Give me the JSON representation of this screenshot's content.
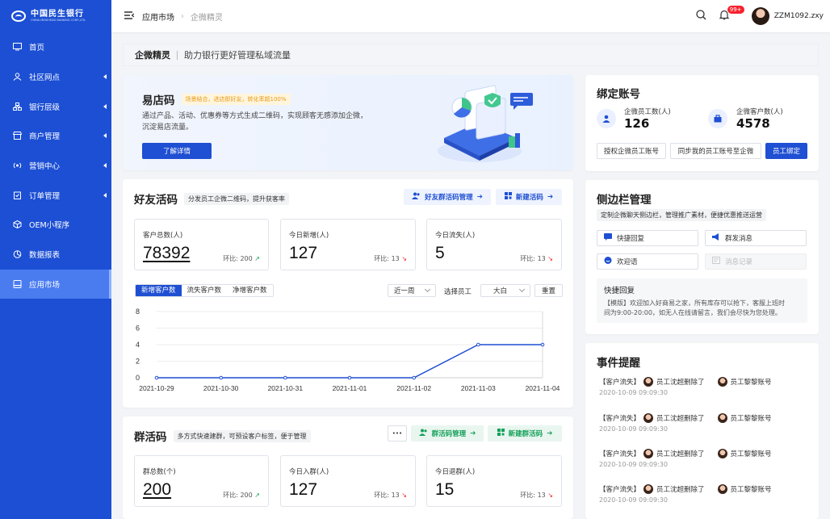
{
  "sidebar": {
    "logo_cn": "中国民生银行",
    "logo_en": "CHINA MINSHENG BANKING CORP.,LTD.",
    "items": [
      {
        "label": "首页",
        "icon": "monitor-icon",
        "submenu": false,
        "active": false
      },
      {
        "label": "社区网点",
        "icon": "community-icon",
        "submenu": true,
        "active": false
      },
      {
        "label": "银行层级",
        "icon": "hierarchy-icon",
        "submenu": true,
        "active": false
      },
      {
        "label": "商户管理",
        "icon": "store-icon",
        "submenu": true,
        "active": false
      },
      {
        "label": "营销中心",
        "icon": "broadcast-icon",
        "submenu": true,
        "active": false
      },
      {
        "label": "订单管理",
        "icon": "clipboard-icon",
        "submenu": true,
        "active": false
      },
      {
        "label": "OEM小程序",
        "icon": "cube-icon",
        "submenu": false,
        "active": false
      },
      {
        "label": "数据报表",
        "icon": "pie-chart-icon",
        "submenu": false,
        "active": false
      },
      {
        "label": "应用市场",
        "icon": "app-icon",
        "submenu": false,
        "active": true
      }
    ]
  },
  "topbar": {
    "breadcrumb": [
      "应用市场",
      "企微精灵"
    ],
    "badge": "99+",
    "username": "ZZM1092.zxy"
  },
  "page_header": {
    "title": "企微精灵",
    "desc": "助力银行更好管理私域流量"
  },
  "easy_store": {
    "title": "易店码",
    "tag": "场景结合，进店即好友，转化率超100%",
    "desc_line1": "通过产品、活动、优惠券等方式生成二维码，实现顾客无感添加企微，",
    "desc_line2": "沉淀易店流量。",
    "button": "了解详情"
  },
  "friend_code": {
    "title": "好友活码",
    "tag": "分发员工企微二维码，提升获客率",
    "btn_manage": "好友群活码管理",
    "btn_new": "新建活码",
    "stats": [
      {
        "label": "客户总数(人)",
        "value": "78392",
        "compare_label": "环比:",
        "compare_value": "200",
        "trend": "up",
        "underline": true
      },
      {
        "label": "今日新增(人)",
        "value": "127",
        "compare_label": "环比:",
        "compare_value": "13",
        "trend": "down",
        "underline": false
      },
      {
        "label": "今日流失(人)",
        "value": "5",
        "compare_label": "环比:",
        "compare_value": "13",
        "trend": "down",
        "underline": false
      }
    ],
    "tabs": [
      "新增客户数",
      "流失客户数",
      "净增客户数"
    ],
    "active_tab": 0,
    "filter_range": "近一周",
    "filter_label": "选择员工",
    "filter_staff": "大白",
    "reset": "重置"
  },
  "chart_data": {
    "type": "line",
    "x": [
      "2021-10-29",
      "2021-10-30",
      "2021-10-31",
      "2021-11-01",
      "2021-11-02",
      "2021-11-03",
      "2021-11-04"
    ],
    "y_ticks": [
      0,
      2,
      4,
      6,
      8
    ],
    "ylim": [
      0,
      8
    ],
    "series": [
      {
        "values": [
          0,
          0,
          0,
          0,
          0,
          4,
          4
        ]
      }
    ],
    "color": "#1f4fd2",
    "grid": true,
    "legend": "none"
  },
  "group_code": {
    "title": "群活码",
    "tag": "多方式快速建群，可预设客户标签，便于管理",
    "more": "•••",
    "btn_manage": "群活码管理",
    "btn_new": "新建群活码",
    "stats": [
      {
        "label": "群总数(个)",
        "value": "200",
        "compare_label": "环比:",
        "compare_value": "200",
        "trend": "up",
        "underline": true
      },
      {
        "label": "今日入群(人)",
        "value": "127",
        "compare_label": "环比:",
        "compare_value": "13",
        "trend": "down",
        "underline": false
      },
      {
        "label": "今日退群(人)",
        "value": "15",
        "compare_label": "环比:",
        "compare_value": "13",
        "trend": "down",
        "underline": false
      }
    ]
  },
  "bind_account": {
    "title": "绑定账号",
    "staff_label": "企微员工数(人)",
    "staff_value": "126",
    "customer_label": "企微客户数(人)",
    "customer_value": "4578",
    "btn_auth": "授权企微员工账号",
    "btn_sync": "同步我的员工账号至企微",
    "btn_bind": "员工绑定"
  },
  "sidebar_mgmt": {
    "title": "侧边栏管理",
    "tag": "定制企微聊天侧边栏，管理推广素材，便捷优惠推送运营",
    "buttons": [
      {
        "label": "快捷回复",
        "icon": "chat-bubble-icon",
        "disabled": false
      },
      {
        "label": "群发消息",
        "icon": "megaphone-icon",
        "disabled": false
      },
      {
        "label": "欢迎语",
        "icon": "smile-chat-icon",
        "disabled": false
      },
      {
        "label": "消息记录",
        "icon": "message-log-icon",
        "disabled": true
      }
    ],
    "quick_reply_title": "快捷回复",
    "quick_reply_line1": "【模版】欢迎加入好商易之家，所有库存可以抢下，客服上班时",
    "quick_reply_line2": "间为9:00-20:00，如无人在线请留言，我们会尽快为您处理。"
  },
  "events": {
    "title": "事件提醒",
    "items": [
      {
        "type": "【客户流失】",
        "text": "员工沈超删除了",
        "target": "员工黎黎账号",
        "time": "2020-10-09 09:09:30"
      },
      {
        "type": "【客户流失】",
        "text": "员工沈超删除了",
        "target": "员工黎黎账号",
        "time": "2020-10-09 09:09:30"
      },
      {
        "type": "【客户流失】",
        "text": "员工沈超删除了",
        "target": "员工黎黎账号",
        "time": "2020-10-09 09:09:30"
      },
      {
        "type": "【客户流失】",
        "text": "员工沈超删除了",
        "target": "员工黎黎账号",
        "time": "2020-10-09 09:09:30"
      }
    ]
  },
  "colors": {
    "primary": "#1f4fd2",
    "sidebar": "#1c4fd4",
    "up": "#16a05a",
    "down": "#f5222d",
    "tag_yellow": "#e89a1c"
  }
}
